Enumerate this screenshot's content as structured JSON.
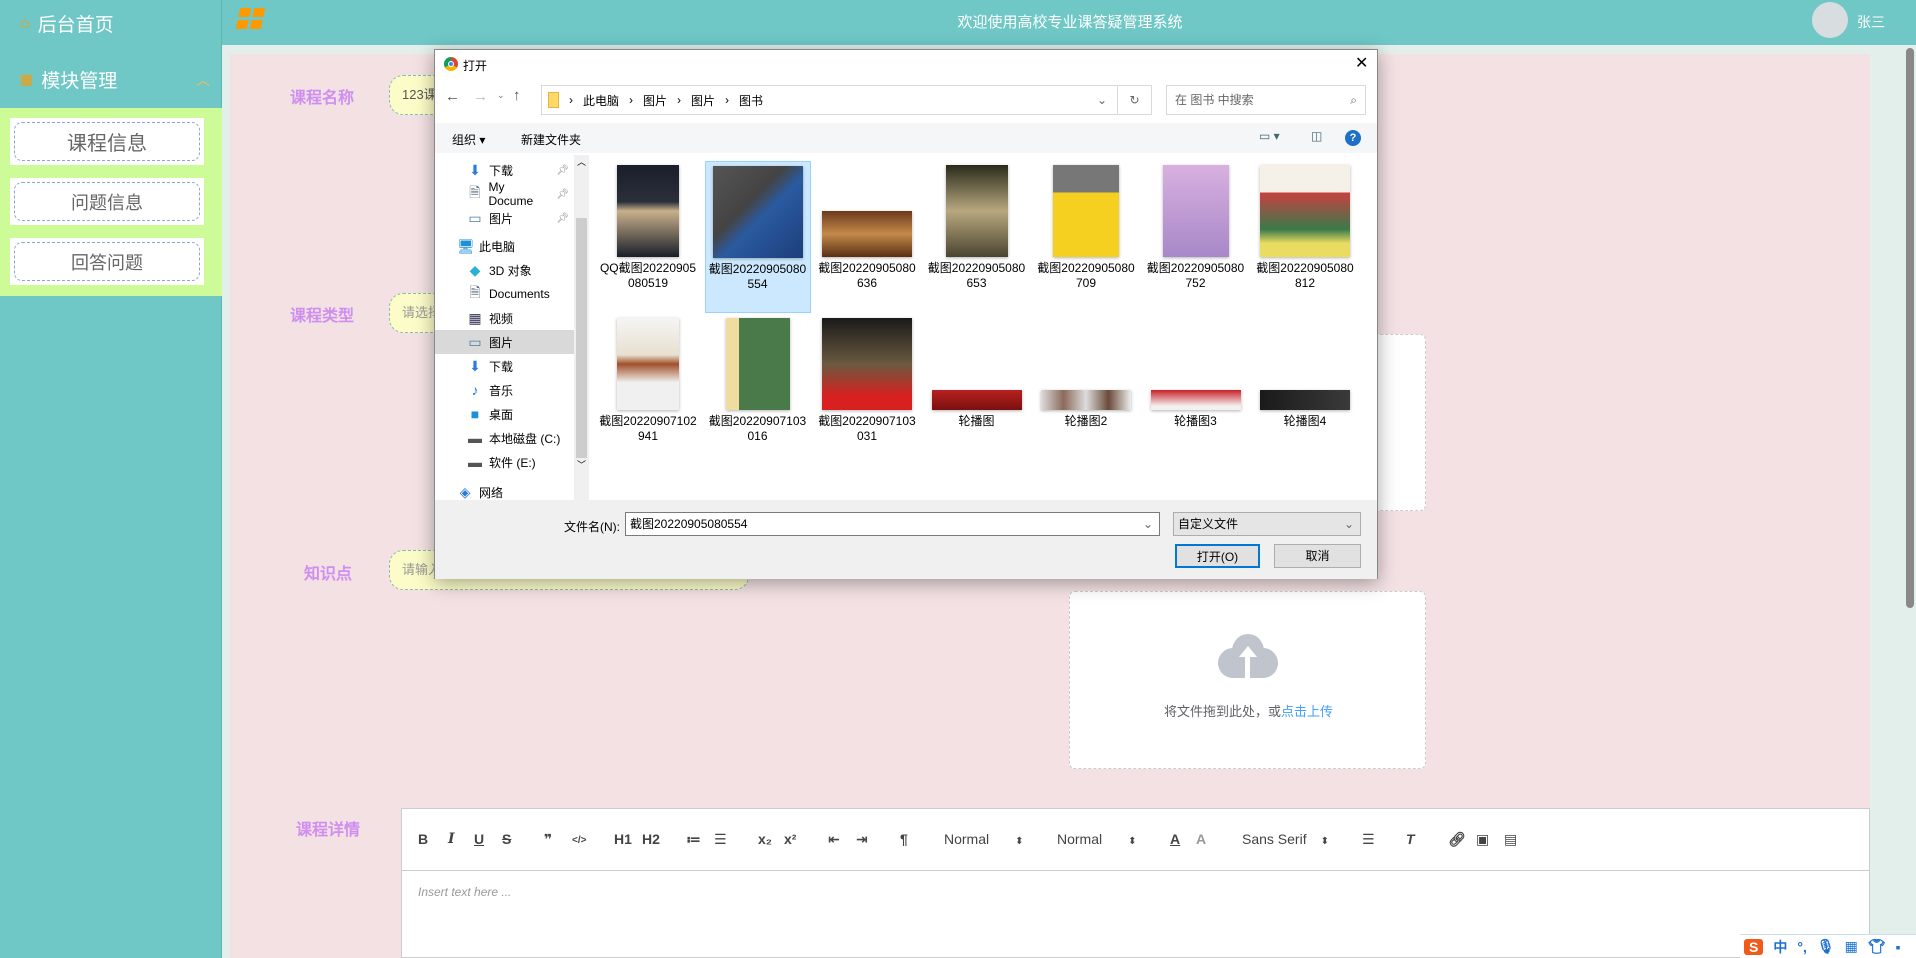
{
  "header": {
    "title": "欢迎使用高校专业课答疑管理系统",
    "user": "张三"
  },
  "sidebar": {
    "home": "后台首页",
    "module": "模块管理",
    "items": [
      {
        "label": "课程信息"
      },
      {
        "label": "问题信息"
      },
      {
        "label": "回答问题"
      }
    ]
  },
  "form": {
    "course_name_label": "课程名称",
    "course_name_value": "123课",
    "course_type_label": "课程类型",
    "course_type_placeholder": "请选择",
    "knowledge_label": "知识点",
    "knowledge_placeholder": "请输入",
    "detail_label": "课程详情",
    "upload_text": "将文件拖到此处，或",
    "upload_link": "点击上传"
  },
  "editor": {
    "placeholder": "Insert text here ...",
    "tools": [
      "B",
      "I",
      "U",
      "S",
      "❞",
      "</>",
      "H1",
      "H2",
      "≔",
      "☰",
      "x₂",
      "x²",
      "⇤",
      "⇥",
      "¶"
    ],
    "size1": "Normal",
    "size2": "Normal",
    "font": "Sans Serif"
  },
  "dialog": {
    "title": "打开",
    "path": [
      "此电脑",
      "图片",
      "图片",
      "图书"
    ],
    "search_placeholder": "在 图书 中搜索",
    "organize": "组织 ▾",
    "new_folder": "新建文件夹",
    "nav": [
      "下载",
      "My Docume",
      "图片",
      "此电脑",
      "3D 对象",
      "Documents",
      "视频",
      "图片",
      "下载",
      "音乐",
      "桌面",
      "本地磁盘 (C:)",
      "软件 (E:)",
      "网络"
    ],
    "files": [
      {
        "name": "QQ截图20220905080519",
        "selected": false
      },
      {
        "name": "截图20220905080554",
        "selected": true
      },
      {
        "name": "截图20220905080636",
        "selected": false
      },
      {
        "name": "截图20220905080653",
        "selected": false
      },
      {
        "name": "截图20220905080709",
        "selected": false
      },
      {
        "name": "截图20220905080752",
        "selected": false
      },
      {
        "name": "截图20220905080812",
        "selected": false
      },
      {
        "name": "截图20220907102941",
        "selected": false
      },
      {
        "name": "截图20220907103016",
        "selected": false
      },
      {
        "name": "截图20220907103031",
        "selected": false
      },
      {
        "name": "轮播图",
        "selected": false
      },
      {
        "name": "轮播图2",
        "selected": false
      },
      {
        "name": "轮播图3",
        "selected": false
      },
      {
        "name": "轮播图4",
        "selected": false
      }
    ],
    "filename_label": "文件名(N):",
    "filename_value": "截图20220905080554",
    "filetype": "自定义文件",
    "open": "打开(O)",
    "cancel": "取消"
  },
  "ime": {
    "lang": "中",
    "punct": "°,"
  }
}
